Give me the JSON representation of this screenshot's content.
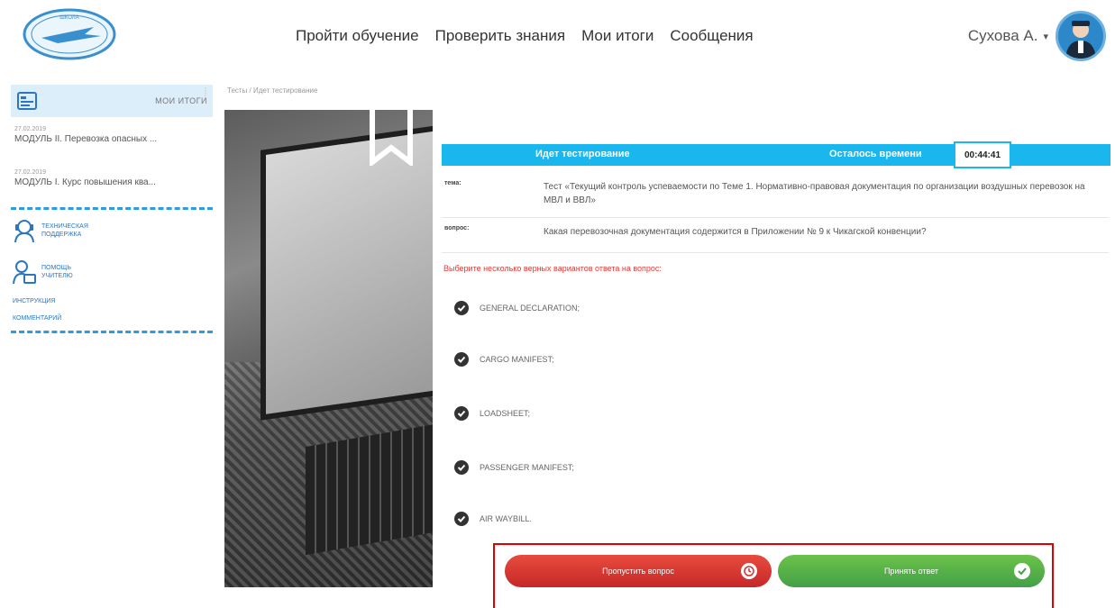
{
  "nav": {
    "items": [
      "Пройти обучение",
      "Проверить знания",
      "Мои итоги",
      "Сообщения"
    ]
  },
  "user": {
    "name": "Сухова А."
  },
  "sidebar": {
    "header_label": "МОИ ИТОГИ",
    "items": [
      {
        "date": "27.02.2019",
        "title": "МОДУЛЬ II. Перевозка опасных ..."
      },
      {
        "date": "27.02.2019",
        "title": "МОДУЛЬ I. Курс повышения ква..."
      }
    ],
    "links": [
      {
        "label_line1": "ТЕХНИЧЕСКАЯ",
        "label_line2": "ПОДДЕРЖКА"
      },
      {
        "label_line1": "ПОМОЩЬ",
        "label_line2": "УЧИТЕЛЮ"
      }
    ],
    "text_links": [
      "ИНСТРУКЦИЯ",
      "КОММЕНТАРИЙ"
    ]
  },
  "breadcrumb": "Тесты / Идет тестирование",
  "test": {
    "status_label": "Идет тестирование",
    "time_left_label": "Осталось времени",
    "timer": "00:44:41",
    "theme_key": "тема:",
    "theme_value": "Тест «Текущий контроль успеваемости по Теме 1. Нормативно-правовая документация по организации воздушных перевозок на МВЛ и ВВЛ»",
    "question_key": "вопрос:",
    "question_value": "Какая перевозочная документация содержится в Приложении № 9 к Чикагской конвенции?",
    "instruction": "Выберите несколько верных вариантов ответа на вопрос:",
    "options": [
      "GENERAL DECLARATION;",
      "CARGO MANIFEST;",
      "LOADSHEET;",
      "PASSENGER MANIFEST;",
      "AIR WAYBILL."
    ],
    "skip_label": "Пропустить вопрос",
    "accept_label": "Принять ответ"
  },
  "colors": {
    "accent": "#1ab7ef",
    "skip": "#d32f2f",
    "accept": "#4caf50",
    "highlight_frame": "#e00000"
  }
}
